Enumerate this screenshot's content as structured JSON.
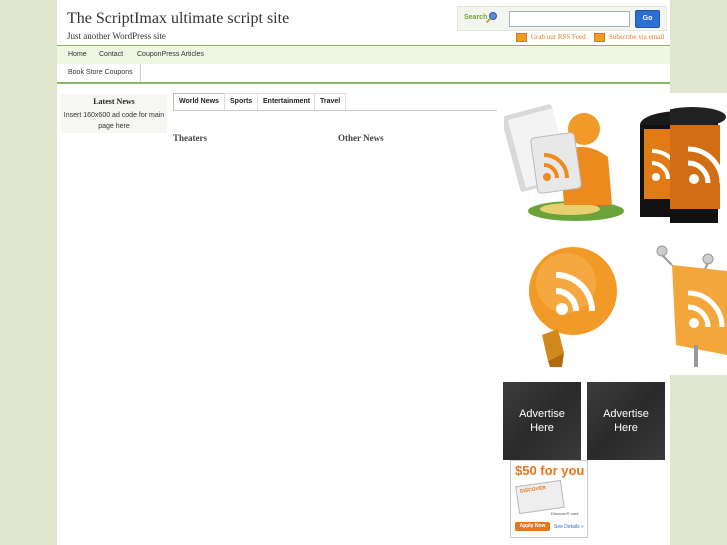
{
  "header": {
    "title": "The ScriptImax ultimate script site",
    "description": "Just another WordPress site"
  },
  "search": {
    "label": "Search",
    "value": "",
    "button": "Go"
  },
  "feeds": {
    "rss": "Grab our RSS Feed",
    "email": "Subscribe via email"
  },
  "nav": {
    "items": [
      "Home",
      "Contact",
      "CouponPress Articles"
    ],
    "sub_items": [
      "Book Store Coupons"
    ]
  },
  "sidebar": {
    "title": "Latest News",
    "text": "Insert 160x600 ad code for main page here"
  },
  "tabs": [
    "World News",
    "Sports",
    "Entertainment",
    "Travel"
  ],
  "columns": [
    "Theaters",
    "Other News"
  ],
  "ads": {
    "box1": "Advertise Here",
    "box2": "Advertise Here"
  },
  "promo": {
    "amount": "$50 for you",
    "brand": "DISCOVER",
    "card_label": "Discover® card",
    "apply": "Apply Now",
    "details": "See Details »"
  },
  "colors": {
    "rss_orange": "#f29a27",
    "nav_green": "#8cb56a",
    "go_blue": "#2d6fd1"
  }
}
